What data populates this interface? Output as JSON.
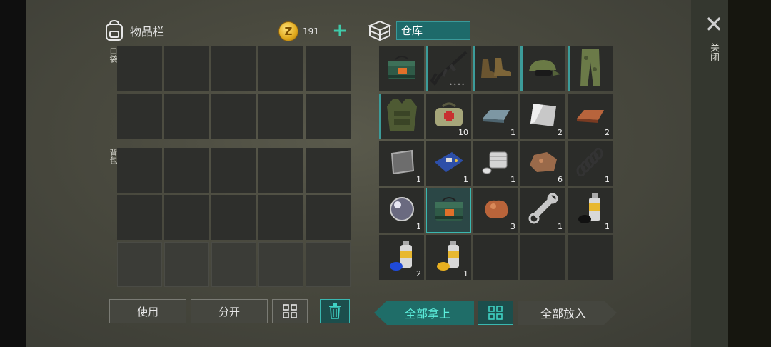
{
  "inventory": {
    "title": "物品栏",
    "coins": "191",
    "pocket_label": "口袋",
    "backpack_label": "背包",
    "pocket_rows": 2,
    "backpack_rows": 3,
    "columns": 5
  },
  "warehouse": {
    "title": "仓库",
    "items": [
      {
        "name": "ammo-box-icon",
        "qty": "",
        "mark": false
      },
      {
        "name": "rifle-icon",
        "qty": "",
        "mark": true,
        "dots": "••••"
      },
      {
        "name": "boots-icon",
        "qty": "",
        "mark": true
      },
      {
        "name": "camo-cap-icon",
        "qty": "",
        "mark": true
      },
      {
        "name": "camo-pants-icon",
        "qty": "",
        "mark": true
      },
      {
        "name": "armor-vest-icon",
        "qty": "",
        "mark": true
      },
      {
        "name": "medkit-bag-icon",
        "qty": "10",
        "mark": false
      },
      {
        "name": "iron-ingot-icon",
        "qty": "1",
        "mark": false
      },
      {
        "name": "steel-plate-icon",
        "qty": "2",
        "mark": false
      },
      {
        "name": "copper-ingot-icon",
        "qty": "2",
        "mark": false
      },
      {
        "name": "metal-plate-icon",
        "qty": "1",
        "mark": false
      },
      {
        "name": "circuit-board-icon",
        "qty": "1",
        "mark": false
      },
      {
        "name": "engine-part-icon",
        "qty": "1",
        "mark": false
      },
      {
        "name": "copper-ore-icon",
        "qty": "6",
        "mark": false
      },
      {
        "name": "spring-icon",
        "qty": "1",
        "mark": false
      },
      {
        "name": "lens-icon",
        "qty": "1",
        "mark": false
      },
      {
        "name": "ammo-box-icon",
        "qty": "",
        "mark": false,
        "selected": true
      },
      {
        "name": "copper-nugget-icon",
        "qty": "3",
        "mark": false
      },
      {
        "name": "wrench-icon",
        "qty": "1",
        "mark": false
      },
      {
        "name": "spray-paint-black-icon",
        "qty": "1",
        "mark": false
      },
      {
        "name": "spray-paint-blue-icon",
        "qty": "2",
        "mark": false
      },
      {
        "name": "spray-paint-yellow-icon",
        "qty": "1",
        "mark": false
      }
    ]
  },
  "buttons": {
    "use": "使用",
    "split": "分开",
    "take_all": "全部拿上",
    "put_all": "全部放入"
  },
  "close": {
    "label": "关闭"
  },
  "colors": {
    "accent": "#3ab7b0",
    "panel": "#4a4a3f",
    "slot": "#2e2f2c"
  }
}
